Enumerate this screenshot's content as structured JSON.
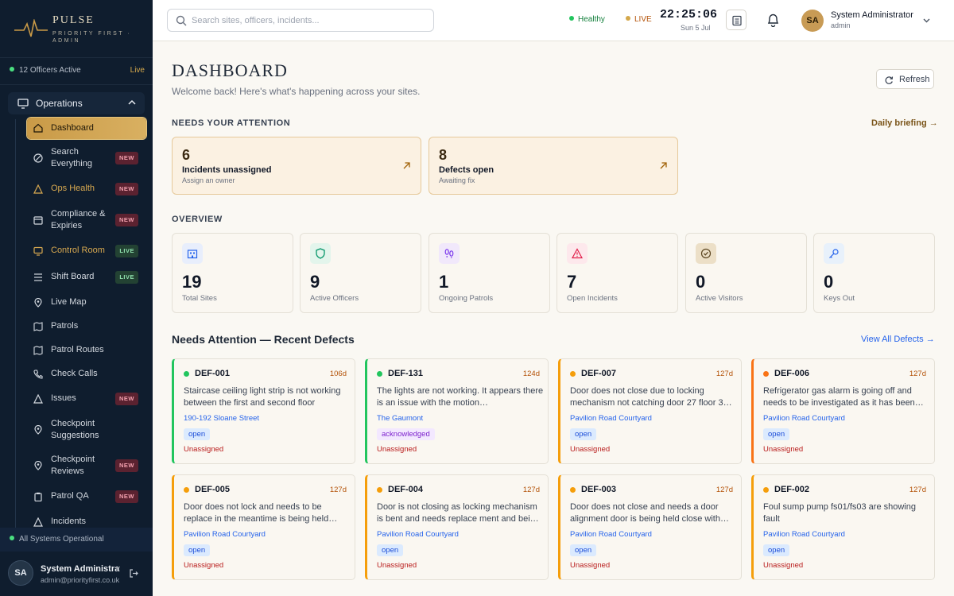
{
  "sidebar": {
    "brand": "PULSE",
    "brand_sub": "PRIORITY FIRST · ADMIN",
    "officers_active": "12 Officers Active",
    "officers_live": "Live",
    "section": "Operations",
    "items": [
      {
        "label": "Dashboard"
      },
      {
        "label": "Search Everything",
        "badge": "NEW"
      },
      {
        "label": "Ops Health",
        "badge": "NEW"
      },
      {
        "label": "Compliance & Expiries",
        "badge": "NEW"
      },
      {
        "label": "Control Room",
        "badge": "LIVE"
      },
      {
        "label": "Shift Board",
        "badge": "LIVE"
      },
      {
        "label": "Live Map"
      },
      {
        "label": "Patrols"
      },
      {
        "label": "Patrol Routes"
      },
      {
        "label": "Check Calls"
      },
      {
        "label": "Issues",
        "badge": "NEW"
      },
      {
        "label": "Checkpoint Suggestions"
      },
      {
        "label": "Checkpoint Reviews",
        "badge": "NEW"
      },
      {
        "label": "Patrol QA",
        "badge": "NEW"
      },
      {
        "label": "Incidents"
      }
    ],
    "system_status": "All Systems Operational",
    "user": {
      "initials": "SA",
      "name": "System Administrator",
      "email": "admin@priorityfirst.co.uk"
    }
  },
  "topbar": {
    "search_placeholder": "Search sites, officers, incidents...",
    "status_healthy": "Healthy",
    "status_live": "LIVE",
    "time": "22:25:06",
    "date": "Sun 5 Jul",
    "user": {
      "initials": "SA",
      "name": "System Administrator",
      "role": "admin"
    }
  },
  "page": {
    "title": "DASHBOARD",
    "subtitle": "Welcome back! Here's what's happening across your sites.",
    "refresh_label": "Refresh"
  },
  "attention": {
    "heading": "NEEDS YOUR ATTENTION",
    "link": "Daily briefing →",
    "cards": [
      {
        "count": "6",
        "title": "Incidents unassigned",
        "sub": "Assign an owner"
      },
      {
        "count": "8",
        "title": "Defects open",
        "sub": "Awaiting fix"
      }
    ]
  },
  "overview": {
    "heading": "OVERVIEW",
    "cards": [
      {
        "value": "19",
        "label": "Total Sites",
        "icon": "building-icon"
      },
      {
        "value": "9",
        "label": "Active Officers",
        "icon": "shield-icon"
      },
      {
        "value": "1",
        "label": "Ongoing Patrols",
        "icon": "footprints-icon"
      },
      {
        "value": "7",
        "label": "Open Incidents",
        "icon": "alert-triangle-icon"
      },
      {
        "value": "0",
        "label": "Active Visitors",
        "icon": "check-circle-icon"
      },
      {
        "value": "0",
        "label": "Keys Out",
        "icon": "key-icon"
      }
    ]
  },
  "defects": {
    "heading": "Needs Attention — Recent Defects",
    "link": "View All Defects →",
    "items": [
      {
        "id": "DEF-001",
        "age": "106d",
        "desc": "Staircase ceiling light strip is not working between the first and second floor",
        "site": "190-192 Sloane Street",
        "status": "open",
        "assignee": "Unassigned",
        "accent": "#22c55e"
      },
      {
        "id": "DEF-131",
        "age": "124d",
        "desc": "The lights are not working. It appears there is an issue with the motion…",
        "site": "The Gaumont",
        "status": "acknowledged",
        "assignee": "Unassigned",
        "accent": "#22c55e"
      },
      {
        "id": "DEF-007",
        "age": "127d",
        "desc": "Door does not close due to locking mechanism not catching door 27 floor 3…",
        "site": "Pavilion Road Courtyard",
        "status": "open",
        "assignee": "Unassigned",
        "accent": "#f59e0b"
      },
      {
        "id": "DEF-006",
        "age": "127d",
        "desc": "Refrigerator gas alarm is going off and needs to be investigated as it has been…",
        "site": "Pavilion Road Courtyard",
        "status": "open",
        "assignee": "Unassigned",
        "accent": "#f97316"
      },
      {
        "id": "DEF-005",
        "age": "127d",
        "desc": "Door does not lock and needs to be replace in the meantime is being held…",
        "site": "Pavilion Road Courtyard",
        "status": "open",
        "assignee": "Unassigned",
        "accent": "#f59e0b"
      },
      {
        "id": "DEF-004",
        "age": "127d",
        "desc": "Door is not closing as locking mechanism is bent and needs replace ment and bei…",
        "site": "Pavilion Road Courtyard",
        "status": "open",
        "assignee": "Unassigned",
        "accent": "#f59e0b"
      },
      {
        "id": "DEF-003",
        "age": "127d",
        "desc": "Door does not close and needs a door alignment door is being held close with…",
        "site": "Pavilion Road Courtyard",
        "status": "open",
        "assignee": "Unassigned",
        "accent": "#f59e0b"
      },
      {
        "id": "DEF-002",
        "age": "127d",
        "desc": "Foul sump pump fs01/fs03 are showing fault",
        "site": "Pavilion Road Courtyard",
        "status": "open",
        "assignee": "Unassigned",
        "accent": "#f59e0b"
      }
    ]
  },
  "colors": {
    "accent_gold": "#c99a47",
    "sidebar_bg": "#0f1d2e",
    "new_badge": "#5b2230",
    "live_badge": "#234233"
  }
}
